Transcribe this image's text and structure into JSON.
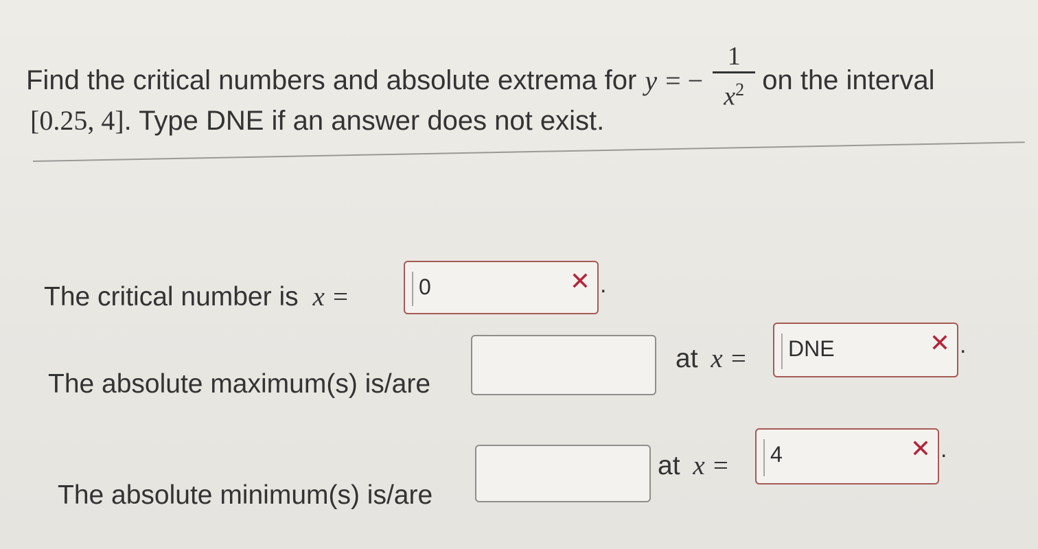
{
  "question": {
    "line1_text": "Find the critical numbers and absolute extrema for",
    "eq_lhs": "y",
    "eq_sign": "= −",
    "frac_numerator": "1",
    "frac_denominator_var": "x",
    "frac_denominator_exp": "2",
    "line1_tail": "on the interval",
    "interval": "[0.25, 4]",
    "line2_text": ". Type DNE if an answer does not exist."
  },
  "rows": {
    "critical": {
      "label": "The critical number is",
      "eq": "x =",
      "value": "0",
      "status": "incorrect"
    },
    "maximum": {
      "label": "The absolute maximum(s) is/are",
      "value_left": "",
      "at_label": "at",
      "eq": "x =",
      "value_right": "DNE",
      "status": "incorrect"
    },
    "minimum": {
      "label": "The absolute minimum(s) is/are",
      "value_left": "",
      "at_label": "at",
      "eq": "x =",
      "value_right": "4",
      "status": "incorrect"
    }
  },
  "icons": {
    "incorrect": "✕"
  },
  "punctuation": ".",
  "colors": {
    "incorrect_mark": "#b5243a",
    "incorrect_border": "#a65a55"
  }
}
